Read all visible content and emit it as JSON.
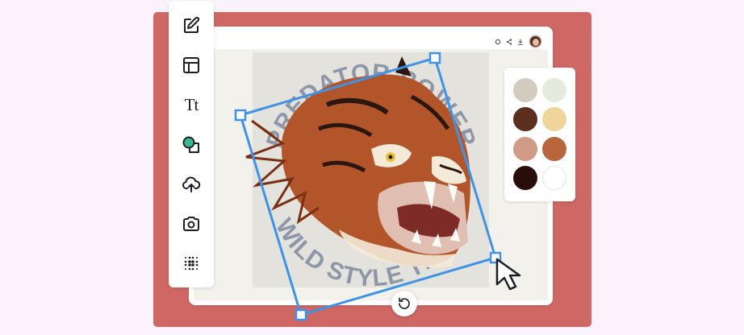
{
  "colors": {
    "page_bg": "#fcf2fb",
    "backdrop": "#cf6764",
    "selection": "#3e93e6",
    "icon": "#1e1e28",
    "shape_fill": "#3ab88f"
  },
  "toolbar": {
    "tools": [
      {
        "name": "edit",
        "icon": "pencil-square-icon"
      },
      {
        "name": "layout",
        "icon": "layout-panel-icon"
      },
      {
        "name": "text",
        "icon": "text-type-icon",
        "label": "Tt"
      },
      {
        "name": "shapes",
        "icon": "shapes-icon"
      },
      {
        "name": "upload",
        "icon": "cloud-upload-icon"
      },
      {
        "name": "photo",
        "icon": "camera-icon"
      },
      {
        "name": "pattern",
        "icon": "halftone-dots-icon"
      }
    ]
  },
  "topbar": {
    "icons": [
      "settings-icon",
      "share-icon",
      "download-icon"
    ],
    "avatar": "user-avatar"
  },
  "design": {
    "arc_text_top": "PREDATOR POWER",
    "arc_text_bottom": "WILD STYLE TIGER",
    "subject": "tiger-head-illustration"
  },
  "palette": {
    "swatches": [
      "#d4cbbf",
      "#e6eadc",
      "#5c2e1d",
      "#f0d59a",
      "#cf9a86",
      "#b9653e",
      "#2a0d0a",
      "#ffffff"
    ]
  },
  "controls": {
    "rotate_icon": "rotate-icon"
  }
}
